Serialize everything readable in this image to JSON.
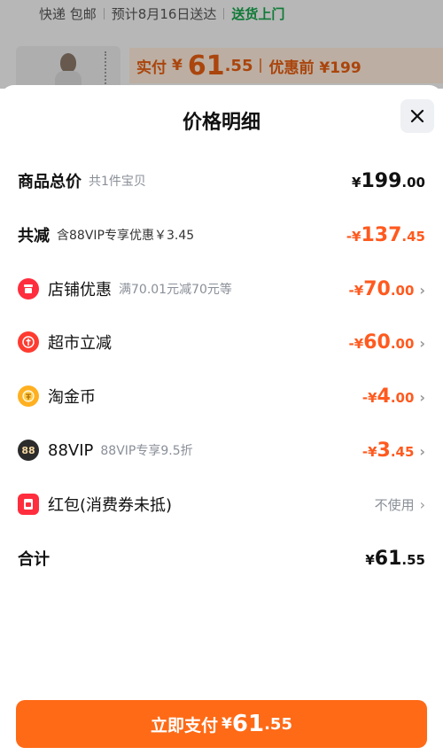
{
  "background": {
    "shipping": {
      "method": "快递 包邮",
      "estimate": "预计8月16日送达",
      "delivery": "送货上门"
    },
    "product_price": {
      "label": "实付",
      "currency": "¥",
      "int": "61",
      "dec": ".55",
      "original": "优惠前 ¥199"
    }
  },
  "sheet": {
    "title": "价格明细",
    "rows": [
      {
        "title": "商品总价",
        "sub": "共1件宝贝",
        "sign": "",
        "currency": "¥",
        "int": "199",
        "dec": ".00"
      },
      {
        "title": "共减",
        "sub": "含88VIP专享优惠￥3.45",
        "sign": "-",
        "currency": "¥",
        "int": "137",
        "dec": ".45"
      },
      {
        "title": "店铺优惠",
        "sub": "满70.01元减70元等",
        "icon": "shop-icon",
        "sign": "-",
        "currency": "¥",
        "int": "70",
        "dec": ".00"
      },
      {
        "title": "超市立减",
        "sub": "",
        "icon": "supermarket-icon",
        "sign": "-",
        "currency": "¥",
        "int": "60",
        "dec": ".00"
      },
      {
        "title": "淘金币",
        "sub": "",
        "icon": "coin-icon",
        "sign": "-",
        "currency": "¥",
        "int": "4",
        "dec": ".00"
      },
      {
        "title": "88VIP",
        "sub": "88VIP专享9.5折",
        "icon": "vip-icon",
        "icon_text": "88",
        "sign": "-",
        "currency": "¥",
        "int": "3",
        "dec": ".45"
      },
      {
        "title": "红包(消费券未抵)",
        "sub": "",
        "icon": "red-packet-icon",
        "status": "不使用"
      },
      {
        "title": "合计",
        "sub": "",
        "sign": "",
        "currency": "¥",
        "int": "61",
        "dec": ".55"
      }
    ]
  },
  "pay_button": {
    "label": "立即支付",
    "currency": "¥",
    "int": "61",
    "dec": ".55"
  },
  "colors": {
    "accent": "#ff6a16",
    "discount": "#ff5a1f",
    "delivery_green": "#16a34a"
  }
}
